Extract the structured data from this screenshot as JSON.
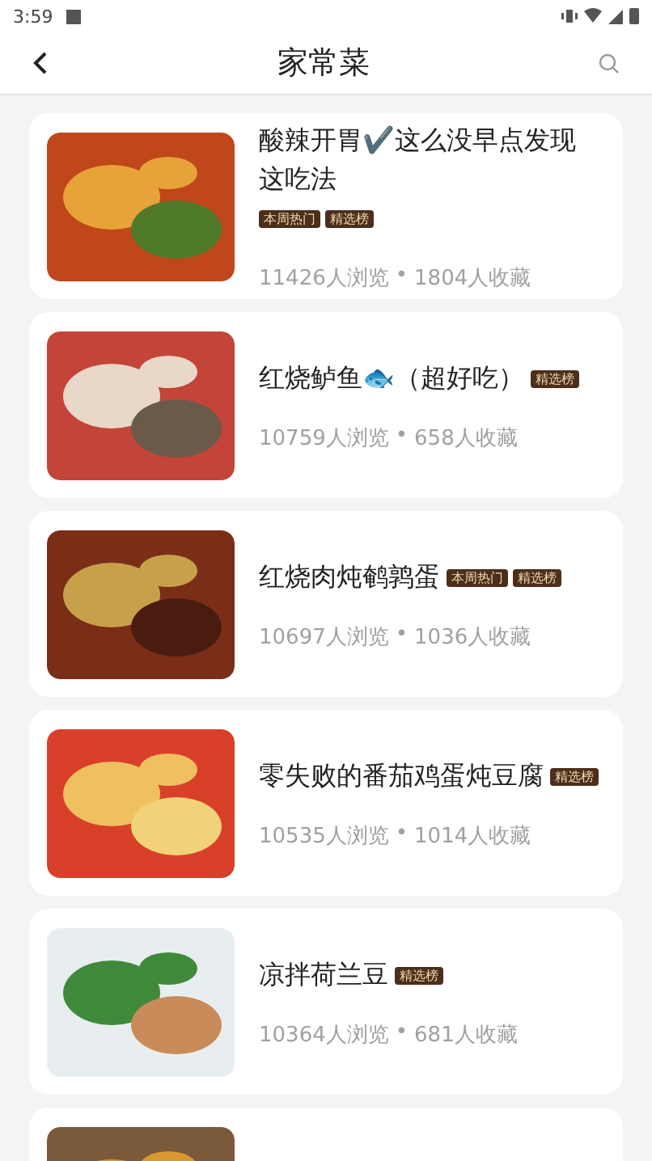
{
  "status_bar": {
    "time": "3:59"
  },
  "header": {
    "title": "家常菜"
  },
  "recipes": [
    {
      "kind": "full",
      "title": "酸辣开胃✔️这么没早点发现这吃法",
      "tags": [
        "本周热门",
        "精选榜"
      ],
      "views": "11426人浏览",
      "dot": "•",
      "favorites": "1804人收藏"
    },
    {
      "kind": "full",
      "title": "红烧鲈鱼🐟（超好吃）",
      "tags": [
        "精选榜"
      ],
      "views": "10759人浏览",
      "dot": "•",
      "favorites": "658人收藏"
    },
    {
      "kind": "full",
      "title": "红烧肉炖鹌鹑蛋",
      "tags": [
        "本周热门",
        "精选榜"
      ],
      "views": "10697人浏览",
      "dot": "•",
      "favorites": "1036人收藏"
    },
    {
      "kind": "full",
      "title": "零失败的番茄鸡蛋炖豆腐",
      "tags": [
        "精选榜"
      ],
      "views": "10535人浏览",
      "dot": "•",
      "favorites": "1014人收藏"
    },
    {
      "kind": "full",
      "title": "凉拌荷兰豆",
      "tags": [
        "精选榜"
      ],
      "views": "10364人浏览",
      "dot": "•",
      "favorites": "681人收藏"
    },
    {
      "kind": "partial"
    }
  ]
}
